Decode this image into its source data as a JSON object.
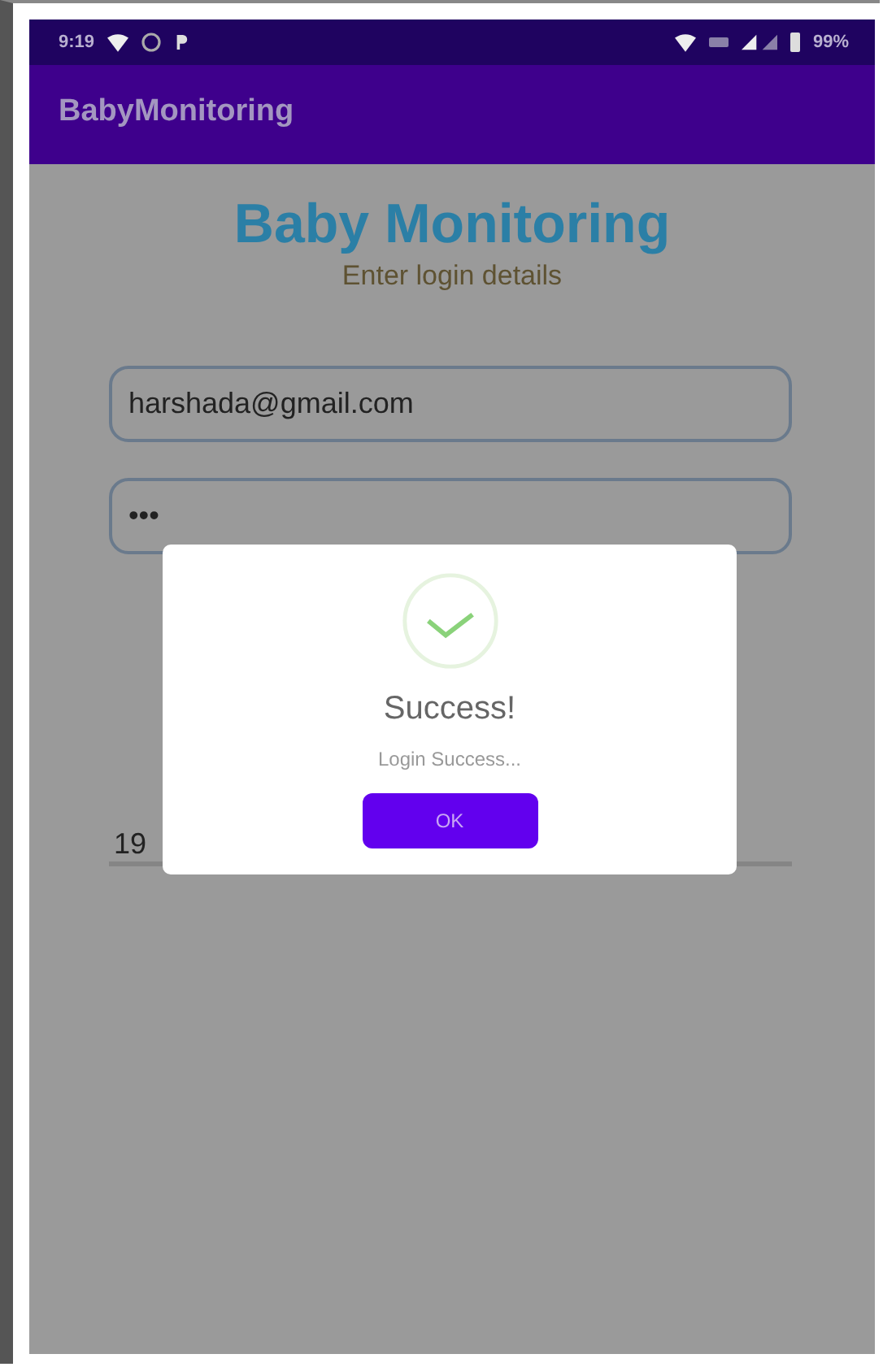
{
  "status_bar": {
    "time": "9:19",
    "battery": "99%"
  },
  "app_bar": {
    "title": "BabyMonitoring"
  },
  "login": {
    "heading": "Baby Monitoring",
    "subheading": "Enter login details",
    "fields": [
      {
        "kind": "outlined",
        "value": "harshada@gmail.com"
      },
      {
        "kind": "outlined",
        "value": "•••"
      },
      {
        "kind": "underlined",
        "value": "19"
      }
    ]
  },
  "dialog": {
    "title": "Success!",
    "message": "Login Success...",
    "button": "OK"
  }
}
